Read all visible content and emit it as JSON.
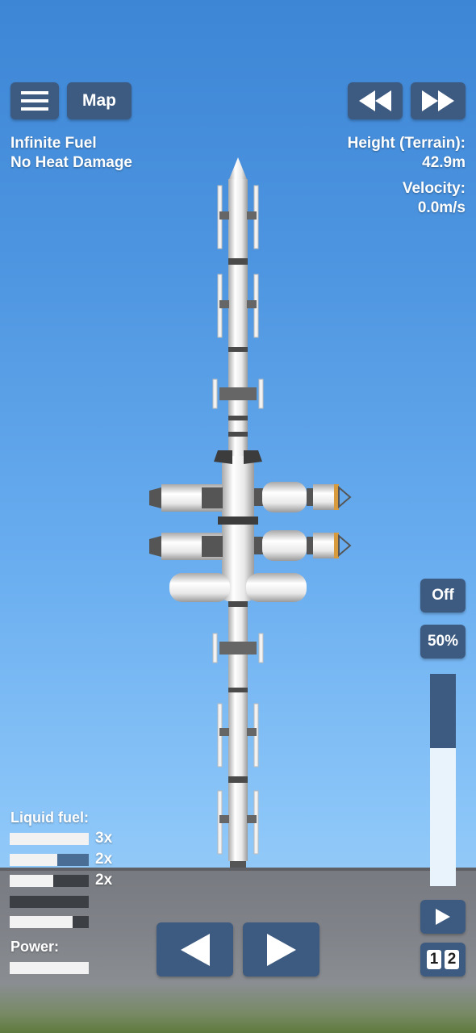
{
  "top_bar": {
    "menu_icon": "hamburger-icon",
    "map_label": "Map",
    "rewind_icon": "rewind-icon",
    "fastforward_icon": "fast-forward-icon"
  },
  "cheats": {
    "line1": "Infinite Fuel",
    "line2": "No Heat Damage"
  },
  "telemetry": {
    "height_label": "Height (Terrain):",
    "height_value": "42.9m",
    "velocity_label": "Velocity:",
    "velocity_value": "0.0m/s"
  },
  "right_panel": {
    "off_label": "Off",
    "throttle_label": "50%",
    "throttle_level": 0.65,
    "play_icon": "play-icon",
    "timewarp_digits": [
      "1",
      "2"
    ]
  },
  "fuel": {
    "label": "Liquid fuel:",
    "tanks": [
      {
        "fill": 1.0,
        "blue": 0.0,
        "mult": "3x"
      },
      {
        "fill": 0.6,
        "blue": 0.4,
        "mult": "2x"
      },
      {
        "fill": 0.55,
        "blue": 0.0,
        "mult": "2x"
      },
      {
        "fill": 0.0,
        "blue": 0.0,
        "mult": ""
      },
      {
        "fill": 0.8,
        "blue": 0.0,
        "mult": ""
      }
    ],
    "power_label": "Power:",
    "power_fill": 1.0
  },
  "controls": {
    "left_icon": "rotate-left-icon",
    "right_icon": "rotate-right-icon"
  },
  "colors": {
    "button": "#3d5a80",
    "sky_top": "#3d86d6",
    "sky_bottom": "#a6d4fb",
    "ground": "#808389"
  }
}
